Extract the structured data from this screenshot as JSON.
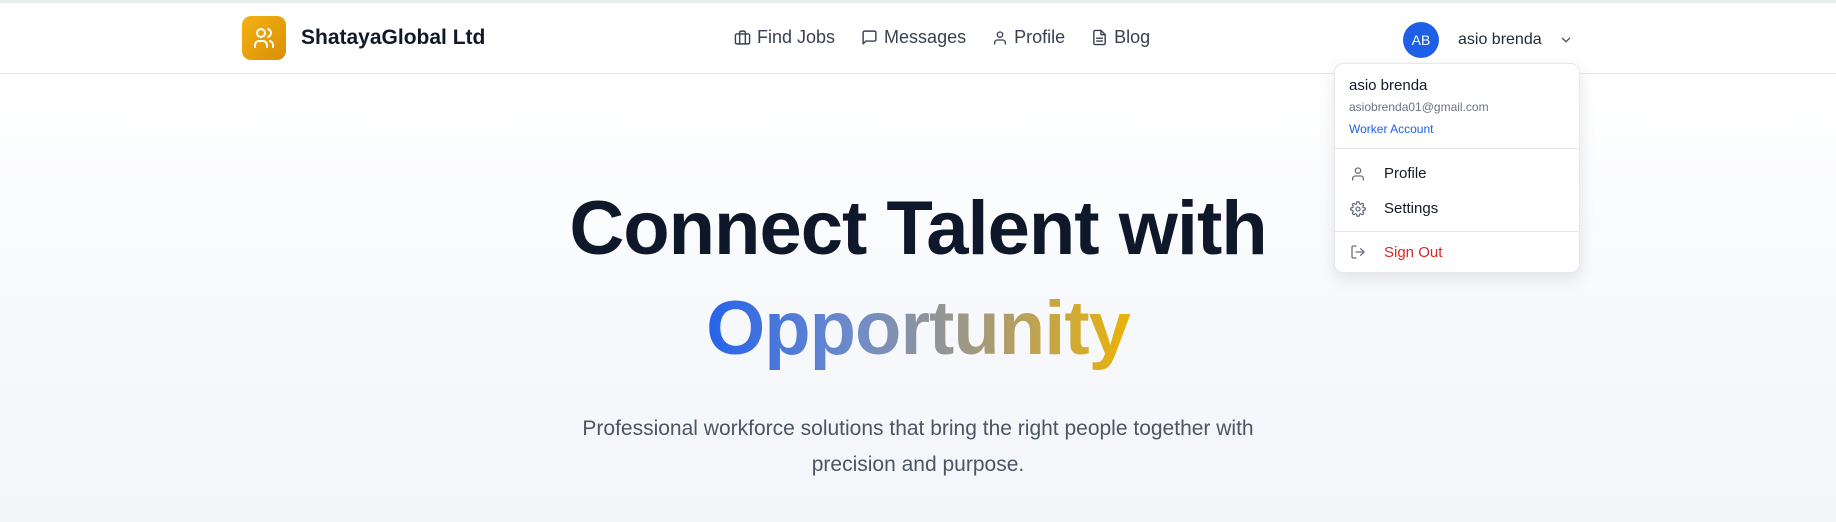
{
  "brand": {
    "name": "ShatayaGlobal Ltd",
    "logo_icon": "users-icon",
    "logo_color": "#f5b212"
  },
  "nav": {
    "items": [
      {
        "label": "Find Jobs",
        "icon": "briefcase-icon"
      },
      {
        "label": "Messages",
        "icon": "message-square-icon"
      },
      {
        "label": "Profile",
        "icon": "user-icon"
      },
      {
        "label": "Blog",
        "icon": "file-text-icon"
      }
    ]
  },
  "user": {
    "initials": "AB",
    "name": "asio brenda",
    "avatar_color": "#1d5fe6"
  },
  "dropdown": {
    "name": "asio brenda",
    "email": "asiobrenda01@gmail.com",
    "account_type": "Worker Account",
    "items": [
      {
        "label": "Profile",
        "icon": "user-icon"
      },
      {
        "label": "Settings",
        "icon": "gear-icon"
      }
    ],
    "signout": {
      "label": "Sign Out",
      "icon": "log-out-icon",
      "color": "#dc2626"
    }
  },
  "hero": {
    "title_line1": "Connect Talent with",
    "title_line2": "Opportunity",
    "subtitle": "Professional workforce solutions that bring the right people together with precision and purpose.",
    "gradient": [
      "#2563eb",
      "#eab308"
    ]
  }
}
